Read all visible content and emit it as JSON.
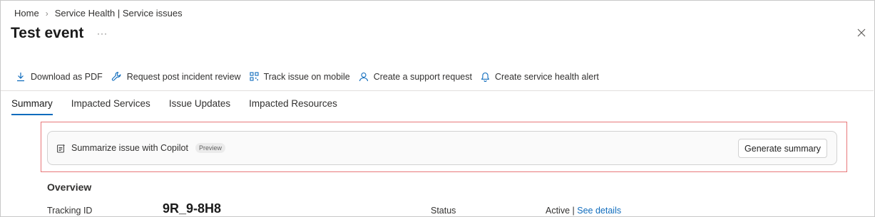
{
  "breadcrumb": {
    "home": "Home",
    "separator": "›",
    "current": "Service Health | Service issues"
  },
  "page": {
    "title": "Test event",
    "more": "···"
  },
  "toolbar": {
    "items": [
      {
        "label": "Download as PDF",
        "icon": "download-icon"
      },
      {
        "label": "Request post incident review",
        "icon": "wrench-icon"
      },
      {
        "label": "Track issue on mobile",
        "icon": "qr-code-icon"
      },
      {
        "label": "Create a support request",
        "icon": "person-icon"
      },
      {
        "label": "Create service health alert",
        "icon": "bell-icon"
      }
    ]
  },
  "tabs": [
    {
      "label": "Summary",
      "active": true
    },
    {
      "label": "Impacted Services",
      "active": false
    },
    {
      "label": "Issue Updates",
      "active": false
    },
    {
      "label": "Impacted Resources",
      "active": false
    }
  ],
  "copilot": {
    "label": "Summarize issue with Copilot",
    "badge": "Preview",
    "button": "Generate summary"
  },
  "overview": {
    "heading": "Overview",
    "tracking_label": "Tracking ID",
    "tracking_value": "9R_9-8H8",
    "status_label": "Status",
    "status_value": "Active",
    "status_sep": " | ",
    "status_link": "See details"
  },
  "colors": {
    "accent": "#0f6cbd",
    "highlight_border": "#e8787a"
  }
}
